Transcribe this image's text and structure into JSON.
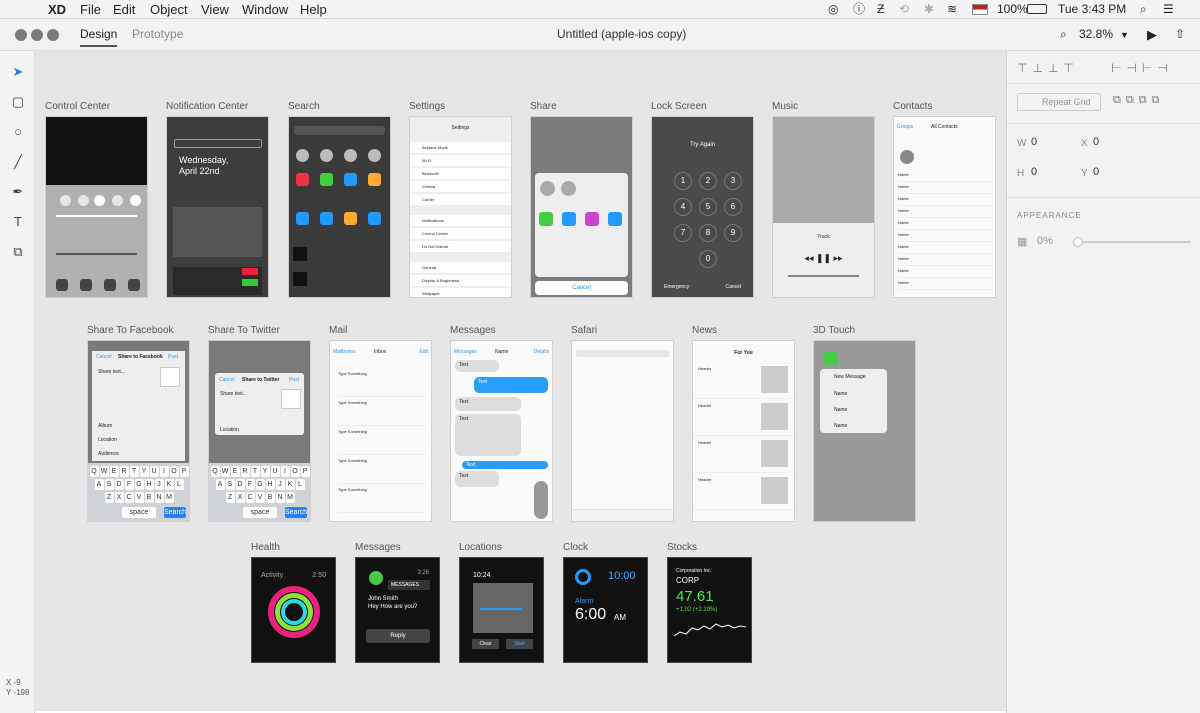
{
  "menubar": {
    "app": "XD",
    "items": [
      "File",
      "Edit",
      "Object",
      "View",
      "Window",
      "Help"
    ],
    "battery": "100%",
    "clock": "Tue 3:43 PM"
  },
  "toolbar": {
    "tabs": [
      "Design",
      "Prototype"
    ],
    "doc_title": "Untitled (apple-ios copy)",
    "zoom": "32.8%"
  },
  "artboards": {
    "row1": [
      "Control Center",
      "Notification Center",
      "Search",
      "Settings",
      "Share",
      "Lock Screen",
      "Music",
      "Contacts"
    ],
    "row2": [
      "Share To Facebook",
      "Share To Twitter",
      "Mail",
      "Messages",
      "Safari",
      "News",
      "3D Touch"
    ],
    "row3": [
      "Health",
      "Messages",
      "Locations",
      "Clock",
      "Stocks"
    ]
  },
  "content": {
    "notif_day": "Wednesday,",
    "notif_date": "April 22nd",
    "lock_title": "Try Again",
    "lock_emergency": "Emergency",
    "lock_cancel": "Cancel",
    "share_cancel": "Cancel",
    "settings_title": "Settings",
    "settings_items": [
      "Airplane Mode",
      "Wi-Fi",
      "Bluetooth",
      "Cellular",
      "Carrier",
      "Notifications",
      "Control Center",
      "Do Not Disturb",
      "General",
      "Display & Brightness",
      "Wallpaper"
    ],
    "contacts_title": "All Contacts",
    "contacts_groups": "Groups",
    "contacts_name": "Name",
    "music_track": "Track",
    "fb_title": "Share to Facebook",
    "fb_cancel": "Cancel",
    "fb_post": "Post",
    "fb_share": "Share text...",
    "fb_album": "Album",
    "fb_location": "Location",
    "fb_audience": "Audience",
    "tw_title": "Share to Twitter",
    "tw_cancel": "Cancel",
    "tw_post": "Post",
    "tw_share": "Share text...",
    "tw_location": "Location",
    "mail_title": "Inbox",
    "mail_back": "Mailboxes",
    "mail_edit": "Edit",
    "mail_subject": "Type Something",
    "msg_title": "Name",
    "msg_back": "Messages",
    "msg_details": "Details",
    "msg_text": "Text",
    "news_title": "For You",
    "news_header": "Header",
    "touch_new": "New Message",
    "touch_name": "Name",
    "watch_activity": "Activity",
    "watch_activity_time": "2:50",
    "watch_msg_app": "MESSAGES",
    "watch_msg_time": "3:26",
    "watch_msg_from": "John Smith",
    "watch_msg_body": "Hey How are you?",
    "watch_msg_reply": "Reply",
    "watch_loc_time": "10:24",
    "watch_loc_clear": "Clear",
    "watch_loc_start": "Start",
    "watch_clock_time": "10:00",
    "watch_clock_alarm": "Alarm",
    "watch_clock_alarm_time": "6:00",
    "watch_clock_ampm": "AM",
    "watch_stock_company": "Corporation Inc.",
    "watch_stock_ticker": "CORP",
    "watch_stock_price": "47.61",
    "watch_stock_change": "+1.02 (+2.19%)",
    "keys_row1": [
      "Q",
      "W",
      "E",
      "R",
      "T",
      "Y",
      "U",
      "I",
      "O",
      "P"
    ],
    "keys_row2": [
      "A",
      "S",
      "D",
      "F",
      "G",
      "H",
      "J",
      "K",
      "L"
    ],
    "keys_row3": [
      "Z",
      "X",
      "C",
      "V",
      "B",
      "N",
      "M"
    ],
    "space": "space",
    "search": "Search"
  },
  "rightpanel": {
    "repeat_grid": "Repeat Grid",
    "w_label": "W",
    "w_value": "0",
    "x_label": "X",
    "x_value": "0",
    "h_label": "H",
    "h_value": "0",
    "y_label": "Y",
    "y_value": "0",
    "appearance": "APPEARANCE",
    "opacity": "0%"
  },
  "cursor": {
    "x_label": "X",
    "x_value": "-9",
    "y_label": "Y",
    "y_value": "-198"
  }
}
